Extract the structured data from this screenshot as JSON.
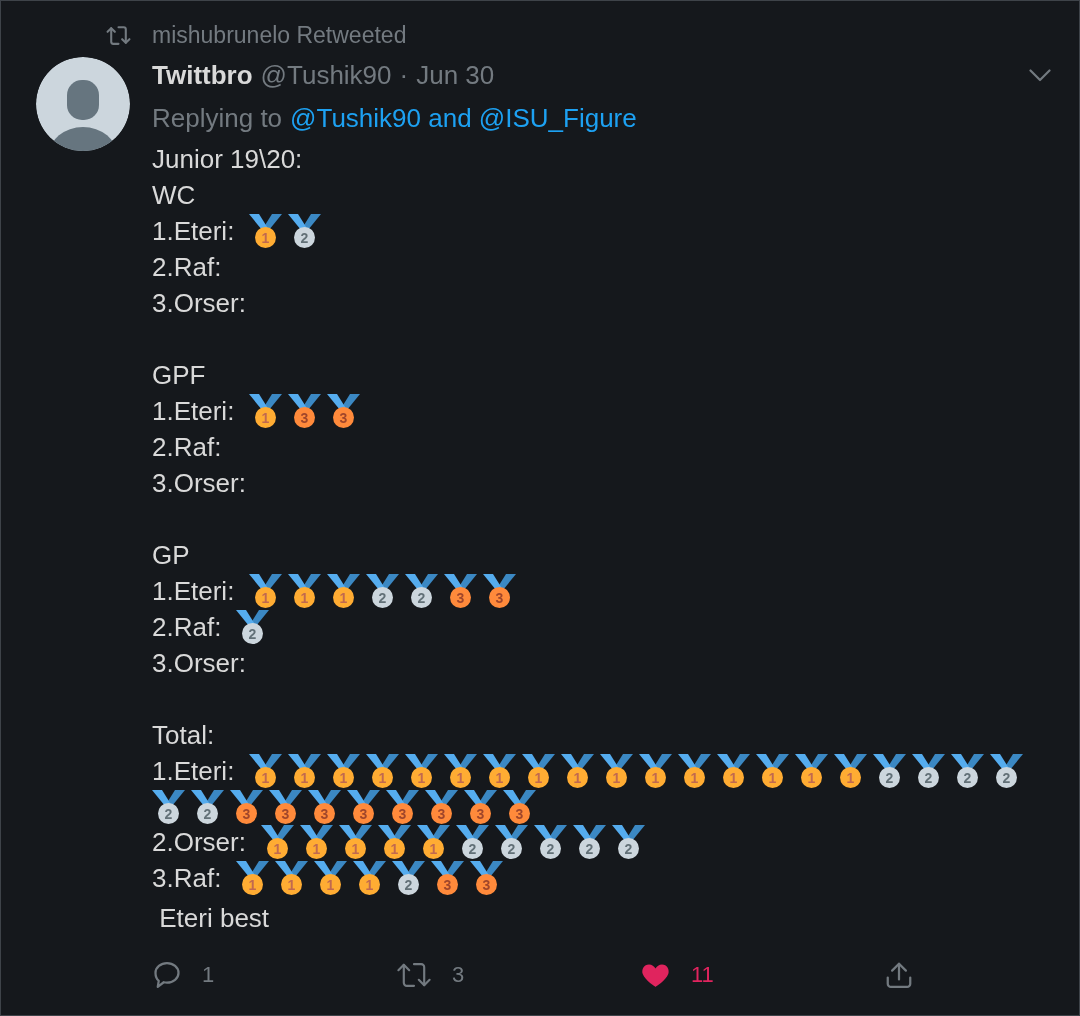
{
  "retweet_banner": {
    "text": "mishubrunelo Retweeted"
  },
  "tweet": {
    "author": {
      "display_name": "Twittbro",
      "handle": "@Tushik90"
    },
    "separator": "·",
    "date": "Jun 30",
    "reply_context": {
      "prefix": "Replying to",
      "recipients": "@Tushik90 and @ISU_Figure"
    },
    "body": {
      "heading": "Junior 19\\20:",
      "sections": [
        {
          "title": "WC",
          "rows": [
            {
              "label": "1.Eteri:",
              "medals": [
                {
                  "place": "1",
                  "kind": "gold"
                },
                {
                  "place": "2",
                  "kind": "silver"
                }
              ]
            },
            {
              "label": "2.Raf:"
            },
            {
              "label": "3.Orser:"
            }
          ]
        },
        {
          "title": "GPF",
          "rows": [
            {
              "label": "1.Eteri:",
              "medals": [
                {
                  "place": "1",
                  "kind": "gold"
                },
                {
                  "place": "3",
                  "kind": "bronze"
                },
                {
                  "place": "3",
                  "kind": "bronze"
                }
              ]
            },
            {
              "label": "2.Raf:"
            },
            {
              "label": "3.Orser:"
            }
          ]
        },
        {
          "title": "GP",
          "rows": [
            {
              "label": "1.Eteri:",
              "medals": [
                {
                  "place": "1",
                  "kind": "gold"
                },
                {
                  "place": "1",
                  "kind": "gold"
                },
                {
                  "place": "1",
                  "kind": "gold"
                },
                {
                  "place": "2",
                  "kind": "silver"
                },
                {
                  "place": "2",
                  "kind": "silver"
                },
                {
                  "place": "3",
                  "kind": "bronze"
                },
                {
                  "place": "3",
                  "kind": "bronze"
                }
              ]
            },
            {
              "label": "2.Raf:",
              "medals": [
                {
                  "place": "2",
                  "kind": "silver"
                }
              ]
            },
            {
              "label": "3.Orser:"
            }
          ]
        },
        {
          "title": "Total:",
          "rows": [
            {
              "label": "1.Eteri:",
              "medals": [
                {
                  "place": "1",
                  "kind": "gold"
                },
                {
                  "place": "1",
                  "kind": "gold"
                },
                {
                  "place": "1",
                  "kind": "gold"
                },
                {
                  "place": "1",
                  "kind": "gold"
                },
                {
                  "place": "1",
                  "kind": "gold"
                },
                {
                  "place": "1",
                  "kind": "gold"
                },
                {
                  "place": "1",
                  "kind": "gold"
                },
                {
                  "place": "1",
                  "kind": "gold"
                },
                {
                  "place": "1",
                  "kind": "gold"
                },
                {
                  "place": "1",
                  "kind": "gold"
                },
                {
                  "place": "1",
                  "kind": "gold"
                },
                {
                  "place": "1",
                  "kind": "gold"
                },
                {
                  "place": "1",
                  "kind": "gold"
                },
                {
                  "place": "1",
                  "kind": "gold"
                },
                {
                  "place": "1",
                  "kind": "gold"
                },
                {
                  "place": "1",
                  "kind": "gold"
                },
                {
                  "place": "2",
                  "kind": "silver"
                },
                {
                  "place": "2",
                  "kind": "silver"
                },
                {
                  "place": "2",
                  "kind": "silver"
                },
                {
                  "place": "2",
                  "kind": "silver"
                },
                {
                  "place": "2",
                  "kind": "silver"
                },
                {
                  "place": "2",
                  "kind": "silver"
                },
                {
                  "place": "3",
                  "kind": "bronze"
                },
                {
                  "place": "3",
                  "kind": "bronze"
                },
                {
                  "place": "3",
                  "kind": "bronze"
                },
                {
                  "place": "3",
                  "kind": "bronze"
                },
                {
                  "place": "3",
                  "kind": "bronze"
                },
                {
                  "place": "3",
                  "kind": "bronze"
                },
                {
                  "place": "3",
                  "kind": "bronze"
                },
                {
                  "place": "3",
                  "kind": "bronze"
                }
              ]
            },
            {
              "label": "2.Orser:",
              "medals": [
                {
                  "place": "1",
                  "kind": "gold"
                },
                {
                  "place": "1",
                  "kind": "gold"
                },
                {
                  "place": "1",
                  "kind": "gold"
                },
                {
                  "place": "1",
                  "kind": "gold"
                },
                {
                  "place": "1",
                  "kind": "gold"
                },
                {
                  "place": "2",
                  "kind": "silver"
                },
                {
                  "place": "2",
                  "kind": "silver"
                },
                {
                  "place": "2",
                  "kind": "silver"
                },
                {
                  "place": "2",
                  "kind": "silver"
                },
                {
                  "place": "2",
                  "kind": "silver"
                }
              ]
            },
            {
              "label": "3.Raf:",
              "medals": [
                {
                  "place": "1",
                  "kind": "gold"
                },
                {
                  "place": "1",
                  "kind": "gold"
                },
                {
                  "place": "1",
                  "kind": "gold"
                },
                {
                  "place": "1",
                  "kind": "gold"
                },
                {
                  "place": "2",
                  "kind": "silver"
                },
                {
                  "place": "3",
                  "kind": "bronze"
                },
                {
                  "place": "3",
                  "kind": "bronze"
                }
              ]
            }
          ]
        }
      ],
      "closing": " Eteri best"
    },
    "actions": [
      {
        "kind": "reply",
        "count": "1",
        "active": false
      },
      {
        "kind": "retweet",
        "count": "3",
        "active": false
      },
      {
        "kind": "like",
        "count": "11",
        "active": true
      },
      {
        "kind": "share",
        "active": false
      }
    ]
  }
}
